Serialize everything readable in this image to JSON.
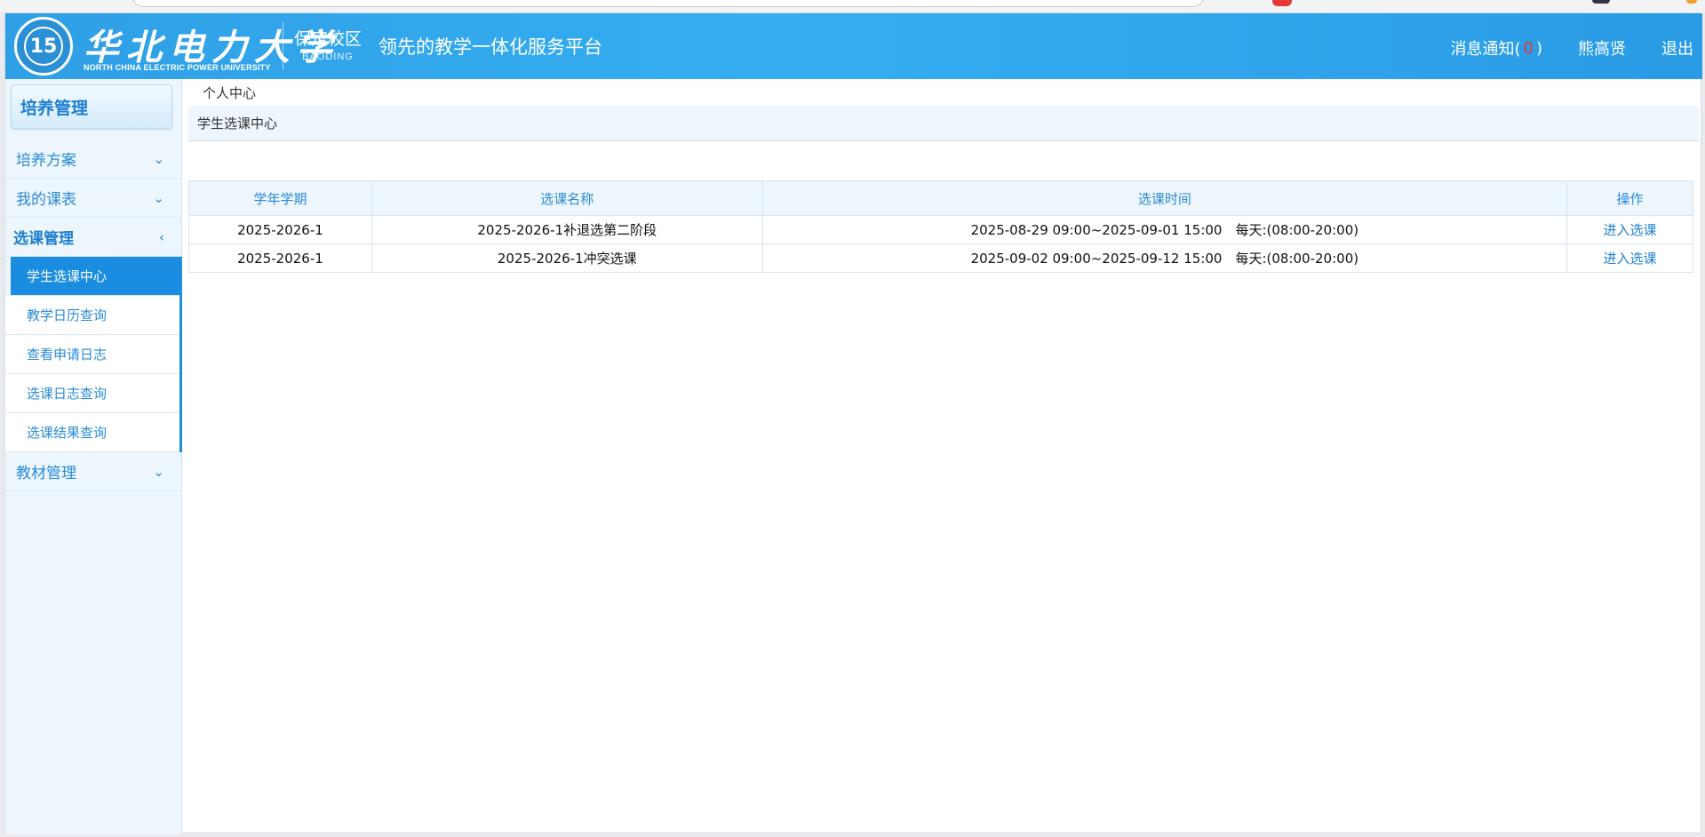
{
  "header": {
    "logo_text": "华北电力大学",
    "logo_en": "NORTH CHINA ELECTRIC POWER UNIVERSITY",
    "campus": "保定校区",
    "campus_en": "BAODING",
    "platform": "领先的教学一体化服务平台",
    "notify_label": "消息通知(",
    "notify_count": "0",
    "notify_close": ")",
    "user_name": "熊高贤",
    "logout": "退出"
  },
  "sidebar": {
    "title": "培养管理",
    "menu": [
      {
        "label": "培养方案",
        "icon": "chevron-down-icon"
      },
      {
        "label": "我的课表",
        "icon": "chevron-down-icon"
      },
      {
        "label": "选课管理",
        "icon": "chevron-left-icon"
      },
      {
        "label": "教材管理",
        "icon": "chevron-down-icon"
      }
    ],
    "submenu": [
      {
        "label": "学生选课中心"
      },
      {
        "label": "教学日历查询"
      },
      {
        "label": "查看申请日志"
      },
      {
        "label": "选课日志查询"
      },
      {
        "label": "选课结果查询"
      }
    ]
  },
  "main": {
    "breadcrumb": "个人中心",
    "section_title": "学生选课中心",
    "table": {
      "headers": [
        "学年学期",
        "选课名称",
        "选课时间",
        "操作"
      ],
      "rows": [
        {
          "term": "2025-2026-1",
          "name": "2025-2026-1补退选第二阶段",
          "time": "2025-08-29 09:00~2025-09-01 15:00　每天:(08:00-20:00)",
          "action": "进入选课"
        },
        {
          "term": "2025-2026-1",
          "name": "2025-2026-1冲突选课",
          "time": "2025-09-02 09:00~2025-09-12 15:00　每天:(08:00-20:00)",
          "action": "进入选课"
        }
      ]
    }
  },
  "colors": {
    "header_blue": "#35aef1",
    "selected_blue": "#1a8de0",
    "link_blue": "#1e7fd0",
    "badge_red": "#e53935"
  }
}
